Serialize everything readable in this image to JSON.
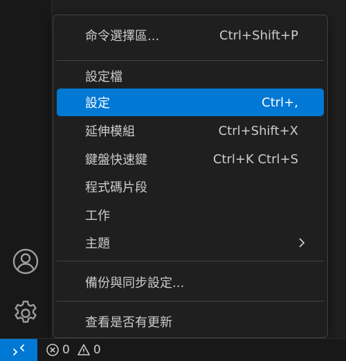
{
  "menu": {
    "items": [
      {
        "label": "命令選擇區...",
        "shortcut": "Ctrl+Shift+P"
      },
      {
        "label": "設定檔",
        "shortcut": ""
      },
      {
        "label": "設定",
        "shortcut": "Ctrl+,"
      },
      {
        "label": "延伸模組",
        "shortcut": "Ctrl+Shift+X"
      },
      {
        "label": "鍵盤快速鍵",
        "shortcut": "Ctrl+K Ctrl+S"
      },
      {
        "label": "程式碼片段",
        "shortcut": ""
      },
      {
        "label": "工作",
        "shortcut": ""
      },
      {
        "label": "主題",
        "shortcut": "",
        "submenu_icon": "chevron-right-icon"
      },
      {
        "label": "備份與同步設定...",
        "shortcut": ""
      },
      {
        "label": "查看是否有更新",
        "shortcut": ""
      }
    ],
    "selected": "設定"
  },
  "activity_bar": {
    "icons": [
      "account-icon",
      "gear-icon"
    ]
  },
  "statusbar": {
    "remote_icon": "remote-icon",
    "errors": "0",
    "warnings": "0"
  },
  "colors": {
    "accent": "#0078d4",
    "menu_bg": "#1f1f1f",
    "border": "#454545",
    "text": "#cccccc"
  }
}
